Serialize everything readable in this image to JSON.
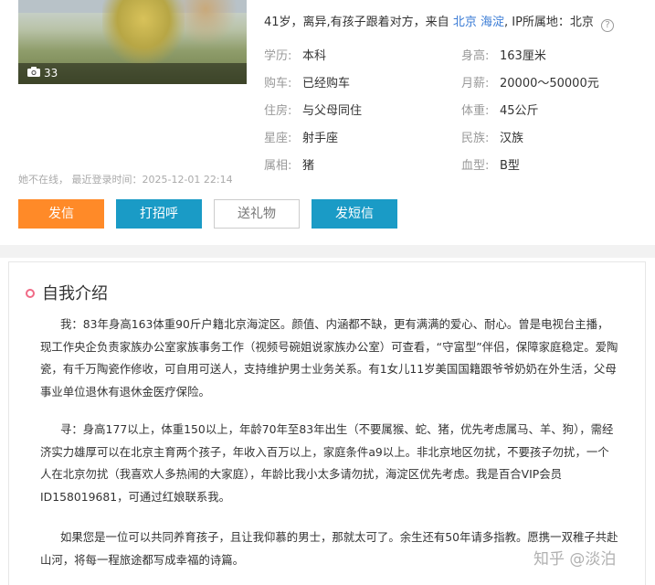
{
  "profile": {
    "photo_count": "33",
    "summary_prefix": "41岁，离异,有孩子跟着对方，来自",
    "location_link": "北京 海淀",
    "ip_label": ", IP所属地：北京",
    "help_glyph": "?",
    "fields_left": [
      {
        "label": "学历:",
        "value": "本科"
      },
      {
        "label": "购车:",
        "value": "已经购车"
      },
      {
        "label": "住房:",
        "value": "与父母同住"
      },
      {
        "label": "星座:",
        "value": "射手座"
      },
      {
        "label": "属相:",
        "value": "猪"
      }
    ],
    "fields_right": [
      {
        "label": "身高:",
        "value": "163厘米"
      },
      {
        "label": "月薪:",
        "value": "20000～50000元"
      },
      {
        "label": "体重:",
        "value": "45公斤"
      },
      {
        "label": "民族:",
        "value": "汉族"
      },
      {
        "label": "血型:",
        "value": "B型"
      }
    ],
    "status": "她不在线，  最近登录时间：2025-12-01 22:14"
  },
  "actions": {
    "mail": "发信",
    "greet": "打招呼",
    "gift": "送礼物",
    "sms": "发短信"
  },
  "intro": {
    "title": "自我介绍",
    "paragraphs": [
      "我：83年身高163体重90斤户籍北京海淀区。颜值、内涵都不缺，更有满满的爱心、耐心。曾是电视台主播，现工作央企负责家族办公室家族事务工作（视频号碗姐说家族办公室）可查看，“守富型”伴侣，保障家庭稳定。爱陶瓷，有千万陶瓷作修收，可自用可送人，支持维护男士业务关系。有1女儿11岁美国国籍跟爷爷奶奶在外生活，父母事业单位退休有退休金医疗保险。",
      "寻：身高177以上，体重150以上，年龄70年至83年出生（不要属猴、蛇、猪，优先考虑属马、羊、狗），需经济实力雄厚可以在北京主育两个孩子，年收入百万以上，家庭条件a9以上。非北京地区勿扰，不要孩子勿扰，一个人在北京勿扰（我喜欢人多热闹的大家庭），年龄比我小太多请勿扰，海淀区优先考虑。我是百合VIP会员ID158019681，可通过红娘联系我。",
      "如果您是一位可以共同养育孩子，且让我仰慕的男士，那就太可了。余生还有50年请多指教。愿携一双稚子共赴山河，将每一程旅途都写成幸福的诗篇。"
    ]
  },
  "watermark": "知乎 @淡泊",
  "colors": {
    "orange": "#ff8a28",
    "blue": "#1a9bc6",
    "link": "#3a7bd5",
    "pink": "#f06a86"
  }
}
